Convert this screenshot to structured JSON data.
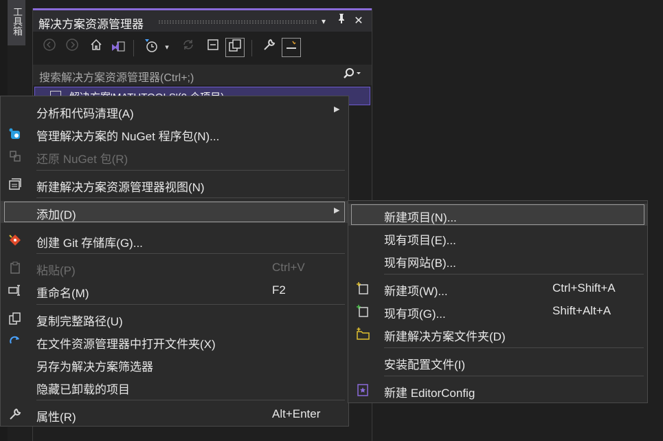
{
  "toolbox": {
    "label": "工具箱"
  },
  "panel": {
    "title": "解决方案资源管理器",
    "title_buttons": {
      "dropdown": "▾",
      "pin": "⊥",
      "close": "✕"
    },
    "search_placeholder": "搜索解决方案资源管理器(Ctrl+;)",
    "tree_item": "解决方案'MATHTOOLS'(0 个项目)",
    "toolbar_icons": [
      "back-icon",
      "forward-icon",
      "home-icon",
      "vs-solution-icon",
      "history-icon",
      "sync-icon",
      "collapse-all-icon",
      "show-all-files-icon",
      "properties-wrench-icon",
      "preview-icon"
    ]
  },
  "context_menu": {
    "items": [
      {
        "label": "分析和代码清理(A)",
        "shortcut": "",
        "submenu": true,
        "icon": "",
        "disabled": false
      },
      {
        "label": "管理解决方案的 NuGet 程序包(N)...",
        "shortcut": "",
        "icon": "nuget-icon",
        "disabled": false
      },
      {
        "label": "还原 NuGet 包(R)",
        "shortcut": "",
        "icon": "restore-packages-icon",
        "disabled": true
      },
      {
        "label": "新建解决方案资源管理器视图(N)",
        "shortcut": "",
        "icon": "new-view-icon",
        "disabled": false
      },
      {
        "label": "添加(D)",
        "shortcut": "",
        "submenu": true,
        "icon": "",
        "disabled": false,
        "active": true
      },
      {
        "label": "创建 Git 存储库(G)...",
        "shortcut": "",
        "icon": "git-icon",
        "disabled": false
      },
      {
        "label": "粘贴(P)",
        "shortcut": "Ctrl+V",
        "icon": "paste-icon",
        "disabled": true
      },
      {
        "label": "重命名(M)",
        "shortcut": "F2",
        "icon": "rename-icon",
        "disabled": false
      },
      {
        "label": "复制完整路径(U)",
        "shortcut": "",
        "icon": "copy-icon",
        "disabled": false
      },
      {
        "label": "在文件资源管理器中打开文件夹(X)",
        "shortcut": "",
        "icon": "open-folder-icon",
        "disabled": false
      },
      {
        "label": "另存为解决方案筛选器",
        "shortcut": "",
        "icon": "",
        "disabled": false
      },
      {
        "label": "隐藏已卸载的项目",
        "shortcut": "",
        "icon": "",
        "disabled": false
      },
      {
        "label": "属性(R)",
        "shortcut": "Alt+Enter",
        "icon": "wrench-icon",
        "disabled": false
      }
    ]
  },
  "add_submenu": {
    "items": [
      {
        "label": "新建项目(N)...",
        "shortcut": "",
        "active": true
      },
      {
        "label": "现有项目(E)...",
        "shortcut": ""
      },
      {
        "label": "现有网站(B)...",
        "shortcut": ""
      },
      {
        "label": "新建项(W)...",
        "shortcut": "Ctrl+Shift+A",
        "icon": "new-item-icon"
      },
      {
        "label": "现有项(G)...",
        "shortcut": "Shift+Alt+A",
        "icon": "existing-item-icon"
      },
      {
        "label": "新建解决方案文件夹(D)",
        "shortcut": "",
        "icon": "new-solution-folder-icon"
      },
      {
        "label": "安装配置文件(I)",
        "shortcut": ""
      },
      {
        "label": "新建 EditorConfig",
        "shortcut": "",
        "icon": "editorconfig-icon"
      }
    ]
  },
  "colors": {
    "accent": "#8a6bd9",
    "background": "#1f1f1f",
    "menu": "#2b2b2b"
  }
}
